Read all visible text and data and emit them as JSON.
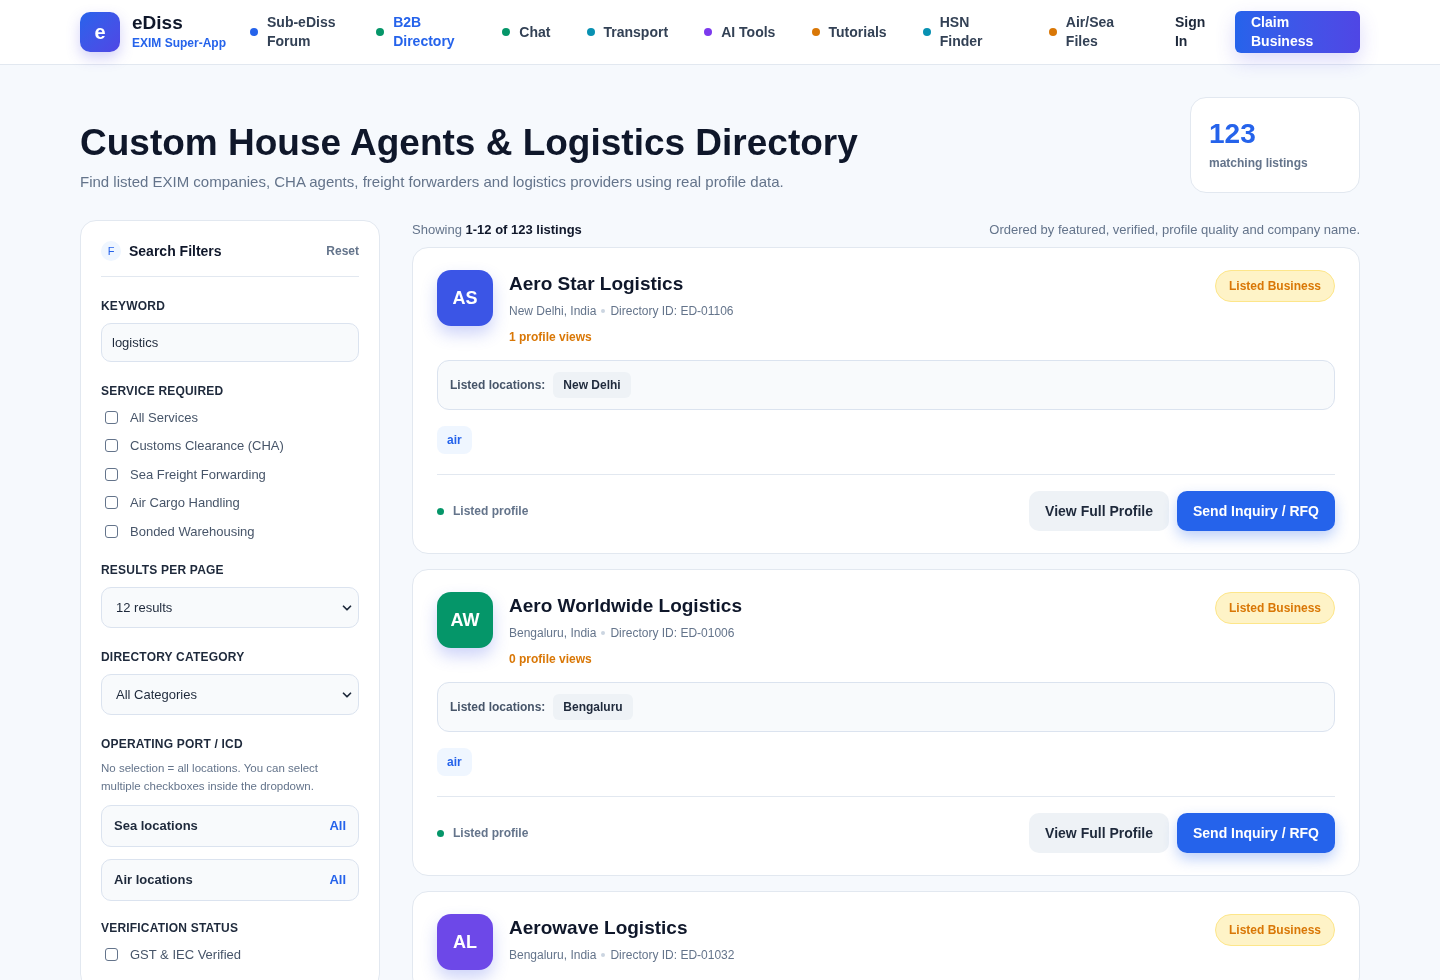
{
  "brand": {
    "logo_letter": "e",
    "name": "eDiss",
    "tagline": "EXIM Super-App"
  },
  "nav": [
    {
      "label": "Sub-eDiss Forum",
      "color": "#2563eb",
      "selected": false
    },
    {
      "label": "B2B Directory",
      "color": "#059669",
      "selected": true
    },
    {
      "label": "Chat",
      "color": "#059669",
      "selected": false
    },
    {
      "label": "Transport",
      "color": "#0891b2",
      "selected": false
    },
    {
      "label": "AI Tools",
      "color": "#7c3aed",
      "selected": false
    },
    {
      "label": "Tutorials",
      "color": "#d97706",
      "selected": false
    },
    {
      "label": "HSN Finder",
      "color": "#0891b2",
      "selected": false
    },
    {
      "label": "Air/Sea Files",
      "color": "#d97706",
      "selected": false
    }
  ],
  "sign_in": "Sign In",
  "claim_button": "Claim Business",
  "page": {
    "title": "Custom House Agents & Logistics Directory",
    "subtitle": "Find listed EXIM companies, CHA agents, freight forwarders and logistics providers using real profile data.",
    "count": "123",
    "count_label": "matching listings"
  },
  "filters": {
    "badge": "F",
    "title": "Search Filters",
    "reset": "Reset",
    "keyword_label": "KEYWORD",
    "keyword_value": "logistics",
    "service_label": "SERVICE REQUIRED",
    "services": [
      {
        "label": "All Services",
        "checked": false
      },
      {
        "label": "Customs Clearance (CHA)",
        "checked": false
      },
      {
        "label": "Sea Freight Forwarding",
        "checked": false
      },
      {
        "label": "Air Cargo Handling",
        "checked": false
      },
      {
        "label": "Bonded Warehousing",
        "checked": false
      }
    ],
    "results_label": "RESULTS PER PAGE",
    "results_value": "12 results",
    "category_label": "DIRECTORY CATEGORY",
    "category_value": "All Categories",
    "port_label": "OPERATING PORT / ICD",
    "port_hint": "No selection = all locations. You can select multiple checkboxes inside the dropdown.",
    "locations": [
      {
        "label": "Sea locations",
        "value": "All"
      },
      {
        "label": "Air locations",
        "value": "All"
      }
    ],
    "verification_label": "VERIFICATION STATUS",
    "verification": [
      {
        "label": "GST & IEC Verified",
        "checked": false
      }
    ]
  },
  "results": {
    "showing_prefix": "Showing",
    "showing_range": "1-12 of 123 listings",
    "order_note": "Ordered by featured, verified, profile quality and company name."
  },
  "listings": [
    {
      "initials": "AS",
      "color": "#3b55e6",
      "name": "Aero Star Logistics",
      "location": "New Delhi, India",
      "directory_id": "Directory ID: ED-01106",
      "views": "1 profile views",
      "badge": "Listed Business",
      "locations_label": "Listed locations:",
      "locations": [
        "New Delhi"
      ],
      "tags": [
        "air"
      ],
      "status": "Listed profile",
      "view_button": "View Full Profile",
      "inquiry_button": "Send Inquiry / RFQ"
    },
    {
      "initials": "AW",
      "color": "#059669",
      "name": "Aero Worldwide Logistics",
      "location": "Bengaluru, India",
      "directory_id": "Directory ID: ED-01006",
      "views": "0 profile views",
      "badge": "Listed Business",
      "locations_label": "Listed locations:",
      "locations": [
        "Bengaluru"
      ],
      "tags": [
        "air"
      ],
      "status": "Listed profile",
      "view_button": "View Full Profile",
      "inquiry_button": "Send Inquiry / RFQ"
    },
    {
      "initials": "AL",
      "color": "#6d48e8",
      "name": "Aerowave Logistics",
      "location": "Bengaluru, India",
      "directory_id": "Directory ID: ED-01032",
      "badge": "Listed Business"
    }
  ]
}
